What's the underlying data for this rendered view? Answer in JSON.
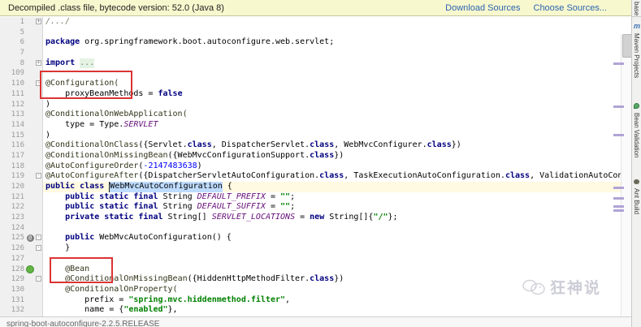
{
  "notification": {
    "message": "Decompiled .class file, bytecode version: 52.0 (Java 8)",
    "download_sources": "Download Sources",
    "choose_sources": "Choose Sources..."
  },
  "editor": {
    "lines": [
      {
        "n": "1",
        "f": "+",
        "tokens": [
          [
            "foldc",
            "/.../"
          ]
        ]
      },
      {
        "n": "5",
        "tokens": []
      },
      {
        "n": "6",
        "tokens": [
          [
            "kw",
            "package"
          ],
          [
            "pl",
            " org.springframework.boot.autoconfigure.web.servlet;"
          ]
        ]
      },
      {
        "n": "7",
        "tokens": []
      },
      {
        "n": "8",
        "f": "+",
        "tokens": [
          [
            "kw",
            "import"
          ],
          [
            "pl",
            " "
          ],
          [
            "foldt",
            "..."
          ]
        ]
      },
      {
        "n": "109",
        "tokens": []
      },
      {
        "n": "110",
        "f": "-",
        "tokens": [
          [
            "ann",
            "@Configuration("
          ]
        ]
      },
      {
        "n": "111",
        "tokens": [
          [
            "pl",
            "    proxyBeanMethods = "
          ],
          [
            "kw",
            "false"
          ]
        ]
      },
      {
        "n": "112",
        "tokens": [
          [
            "pl",
            ")"
          ]
        ]
      },
      {
        "n": "113",
        "tokens": [
          [
            "ann",
            "@ConditionalOnWebApplication("
          ]
        ]
      },
      {
        "n": "114",
        "tokens": [
          [
            "pl",
            "    type = Type."
          ],
          [
            "const",
            "SERVLET"
          ]
        ]
      },
      {
        "n": "115",
        "tokens": [
          [
            "pl",
            ")"
          ]
        ]
      },
      {
        "n": "116",
        "tokens": [
          [
            "ann",
            "@ConditionalOnClass"
          ],
          [
            "pl",
            "({Servlet."
          ],
          [
            "kw",
            "class"
          ],
          [
            "pl",
            ", DispatcherServlet."
          ],
          [
            "kw",
            "class"
          ],
          [
            "pl",
            ", WebMvcConfigurer."
          ],
          [
            "kw",
            "class"
          ],
          [
            "pl",
            "})"
          ]
        ]
      },
      {
        "n": "117",
        "tokens": [
          [
            "ann",
            "@ConditionalOnMissingBean"
          ],
          [
            "pl",
            "({WebMvcConfigurationSupport."
          ],
          [
            "kw",
            "class"
          ],
          [
            "pl",
            "})"
          ]
        ]
      },
      {
        "n": "118",
        "tokens": [
          [
            "ann",
            "@AutoConfigureOrder"
          ],
          [
            "pl",
            "("
          ],
          [
            "num",
            "-2147483638"
          ],
          [
            "pl",
            ")"
          ]
        ]
      },
      {
        "n": "119",
        "f": "-",
        "tokens": [
          [
            "ann",
            "@AutoConfigureAfter"
          ],
          [
            "pl",
            "({DispatcherServletAutoConfiguration."
          ],
          [
            "kw",
            "class"
          ],
          [
            "pl",
            ", TaskExecutionAutoConfiguration."
          ],
          [
            "kw",
            "class"
          ],
          [
            "pl",
            ", ValidationAutoCon"
          ]
        ]
      },
      {
        "n": "120",
        "caret": true,
        "tokens": [
          [
            "kw",
            "public"
          ],
          [
            "pl",
            " "
          ],
          [
            "kw",
            "class"
          ],
          [
            "pl",
            " "
          ],
          [
            "hl",
            "WebMvcAutoConfiguration"
          ],
          [
            "pl",
            " {"
          ]
        ]
      },
      {
        "n": "121",
        "tokens": [
          [
            "pl",
            "    "
          ],
          [
            "kw",
            "public static final"
          ],
          [
            "pl",
            " String "
          ],
          [
            "const",
            "DEFAULT_PREFIX"
          ],
          [
            "pl",
            " = "
          ],
          [
            "str",
            "\"\""
          ],
          [
            "pl",
            ";"
          ]
        ]
      },
      {
        "n": "122",
        "tokens": [
          [
            "pl",
            "    "
          ],
          [
            "kw",
            "public static final"
          ],
          [
            "pl",
            " String "
          ],
          [
            "const",
            "DEFAULT_SUFFIX"
          ],
          [
            "pl",
            " = "
          ],
          [
            "str",
            "\"\""
          ],
          [
            "pl",
            ";"
          ]
        ]
      },
      {
        "n": "123",
        "tokens": [
          [
            "pl",
            "    "
          ],
          [
            "kw",
            "private static final"
          ],
          [
            "pl",
            " String[] "
          ],
          [
            "const",
            "SERVLET_LOCATIONS"
          ],
          [
            "pl",
            " = "
          ],
          [
            "kw",
            "new"
          ],
          [
            "pl",
            " String[]{"
          ],
          [
            "str",
            "\"/\""
          ],
          [
            "pl",
            "};"
          ]
        ]
      },
      {
        "n": "124",
        "tokens": []
      },
      {
        "n": "125",
        "g": "override",
        "f": "-",
        "tokens": [
          [
            "pl",
            "    "
          ],
          [
            "kw",
            "public"
          ],
          [
            "pl",
            " WebMvcAutoConfiguration() {"
          ]
        ]
      },
      {
        "n": "126",
        "f": "-",
        "tokens": [
          [
            "pl",
            "    }"
          ]
        ]
      },
      {
        "n": "127",
        "tokens": []
      },
      {
        "n": "128",
        "g": "bean",
        "tokens": [
          [
            "pl",
            "    "
          ],
          [
            "ann",
            "@Bean"
          ]
        ]
      },
      {
        "n": "129",
        "f": "-",
        "tokens": [
          [
            "pl",
            "    "
          ],
          [
            "ann",
            "@ConditionalOnMissingBean"
          ],
          [
            "pl",
            "({HiddenHttpMethodFilter."
          ],
          [
            "kw",
            "class"
          ],
          [
            "pl",
            "})"
          ]
        ]
      },
      {
        "n": "130",
        "tokens": [
          [
            "pl",
            "    "
          ],
          [
            "ann",
            "@ConditionalOnProperty("
          ]
        ]
      },
      {
        "n": "131",
        "tokens": [
          [
            "pl",
            "        prefix = "
          ],
          [
            "str",
            "\"spring.mvc.hiddenmethod.filter\""
          ],
          [
            "pl",
            ","
          ]
        ]
      },
      {
        "n": "132",
        "tokens": [
          [
            "pl",
            "        name = {"
          ],
          [
            "str",
            "\"enabled\""
          ],
          [
            "pl",
            "},"
          ]
        ]
      }
    ],
    "stripe_marks_y": [
      56,
      109,
      144,
      209,
      222,
      232,
      237
    ]
  },
  "sidebar": {
    "tabs": [
      {
        "label": "base"
      },
      {
        "icon": "m",
        "label": "Maven Projects"
      },
      {
        "label": "Bean Validation"
      },
      {
        "label": "Ant Build"
      }
    ]
  },
  "breadcrumb": {
    "text": "spring-boot-autoconfigure-2.2.5.RELEASE"
  },
  "watermark": {
    "text": "狂神说"
  }
}
